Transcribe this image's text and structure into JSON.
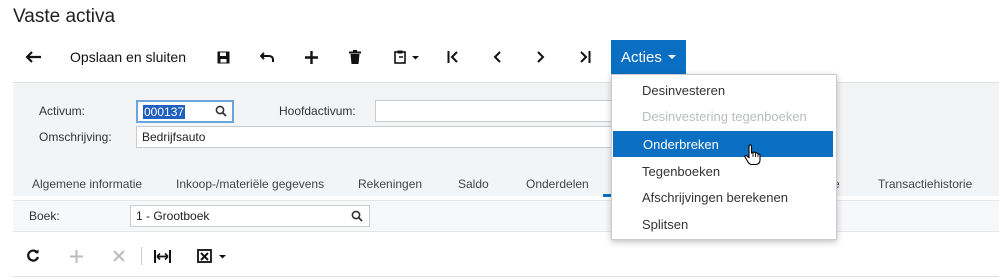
{
  "page": {
    "title": "Vaste activa"
  },
  "toolbar": {
    "save_close_label": "Opslaan en sluiten",
    "acties_label": "Acties"
  },
  "form": {
    "activum_label": "Activum:",
    "activum_value": "000137",
    "hoofdactivum_label": "Hoofdactivum:",
    "hoofdactivum_value": "",
    "omschrijving_label": "Omschrijving:",
    "omschrijving_value": "Bedrijfsauto"
  },
  "tabs": [
    {
      "label": "Algemene informatie"
    },
    {
      "label": "Inkoop-/materiële gegevens"
    },
    {
      "label": "Rekeningen"
    },
    {
      "label": "Saldo"
    },
    {
      "label": "Onderdelen"
    },
    {
      "label": "e"
    },
    {
      "label": "Transactiehistorie"
    }
  ],
  "boek": {
    "label": "Boek:",
    "value": "1 - Grootboek"
  },
  "menu": {
    "items": [
      {
        "label": "Desinvesteren",
        "state": "normal"
      },
      {
        "label": "Desinvestering tegenboeken",
        "state": "disabled"
      },
      {
        "label": "Onderbreken",
        "state": "active"
      },
      {
        "label": "Tegenboeken",
        "state": "normal"
      },
      {
        "label": "Afschrijvingen berekenen",
        "state": "normal"
      },
      {
        "label": "Splitsen",
        "state": "normal"
      }
    ]
  },
  "icons": [
    "back-arrow-icon",
    "save-icon",
    "undo-icon",
    "plus-icon",
    "trash-icon",
    "clipboard-icon",
    "first-icon",
    "prev-icon",
    "next-icon",
    "last-icon",
    "search-icon",
    "refresh-icon",
    "close-icon",
    "fit-width-icon",
    "excel-icon",
    "hand-cursor-icon"
  ],
  "colors": {
    "accent": "#0a6fc2",
    "panel": "#f3f4f5"
  }
}
